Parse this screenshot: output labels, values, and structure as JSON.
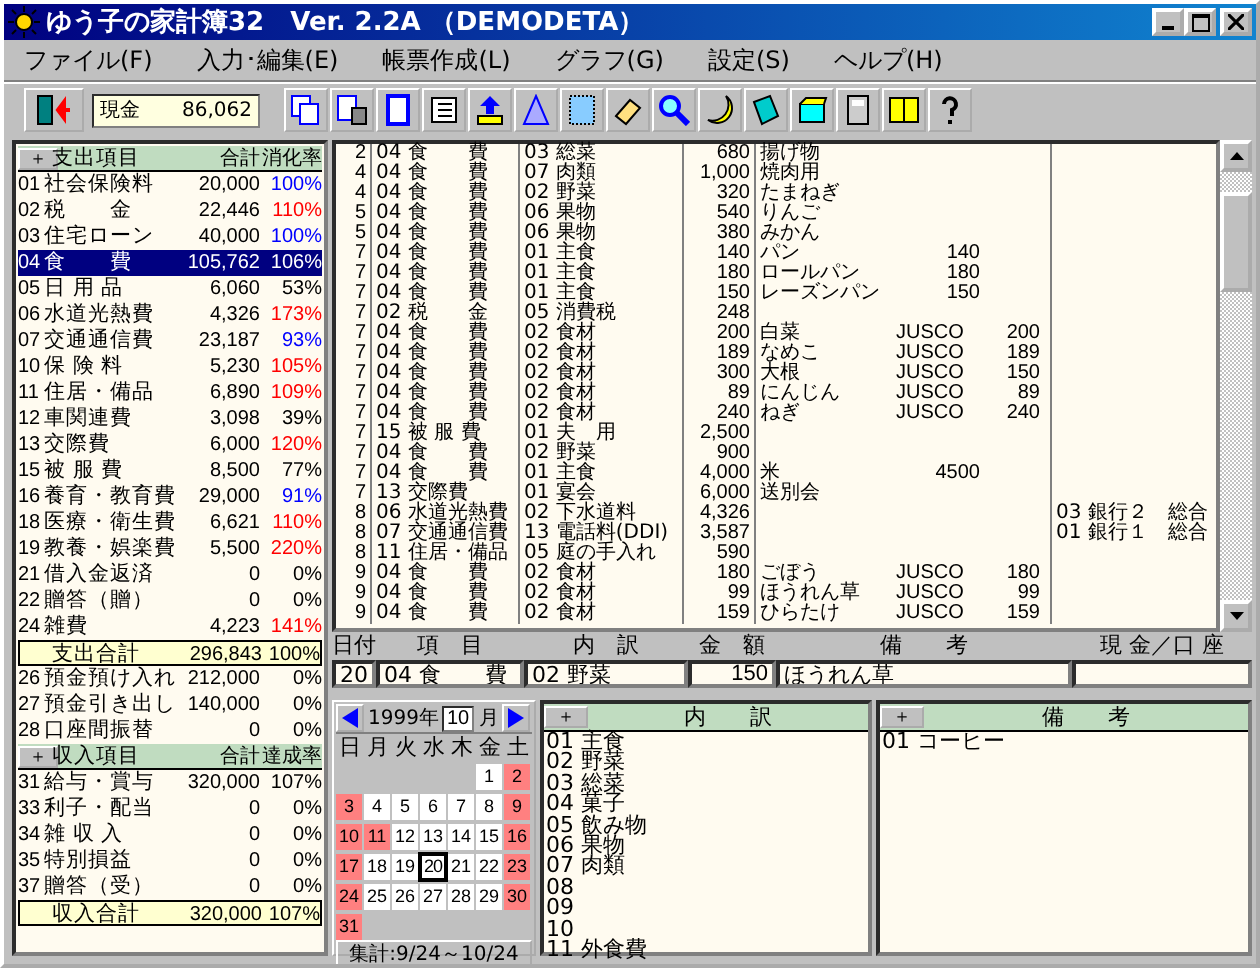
{
  "window": {
    "title": "ゆう子の家計簿32　Ver. 2.2A （DEMODETA）"
  },
  "menu": [
    "ファイル(F)",
    "入力･編集(E)",
    "帳票作成(L)",
    "グラフ(G)",
    "設定(S)",
    "ヘルプ(H)"
  ],
  "toolbar": {
    "cash_label": "現金",
    "cash_value": "86,062"
  },
  "expense": {
    "header": {
      "button": "＋",
      "title": "支出項目",
      "total": "合計",
      "rate": "消化率"
    },
    "items": [
      {
        "code": "01",
        "name": "社会保険料",
        "amount": "20,000",
        "rate": "100%",
        "color": "#0000ff",
        "selected": false
      },
      {
        "code": "02",
        "name": "税　　金",
        "amount": "22,446",
        "rate": "110%",
        "color": "#ff0000",
        "selected": false
      },
      {
        "code": "03",
        "name": "住宅ローン",
        "amount": "40,000",
        "rate": "100%",
        "color": "#0000ff",
        "selected": false
      },
      {
        "code": "04",
        "name": "食　　費",
        "amount": "105,762",
        "rate": "106%",
        "selected": true
      },
      {
        "code": "05",
        "name": "日 用 品",
        "amount": "6,060",
        "rate": "53%",
        "color": "#000000",
        "selected": false
      },
      {
        "code": "06",
        "name": "水道光熱費",
        "amount": "4,326",
        "rate": "173%",
        "color": "#ff0000",
        "selected": false
      },
      {
        "code": "07",
        "name": "交通通信費",
        "amount": "23,187",
        "rate": "93%",
        "color": "#0000ff",
        "selected": false
      },
      {
        "code": "10",
        "name": "保 険 料",
        "amount": "5,230",
        "rate": "105%",
        "color": "#ff0000",
        "selected": false
      },
      {
        "code": "11",
        "name": "住居・備品",
        "amount": "6,890",
        "rate": "109%",
        "color": "#ff0000",
        "selected": false
      },
      {
        "code": "12",
        "name": "車関連費",
        "amount": "3,098",
        "rate": "39%",
        "color": "#000000",
        "selected": false
      },
      {
        "code": "13",
        "name": "交際費",
        "amount": "6,000",
        "rate": "120%",
        "color": "#ff0000",
        "selected": false
      },
      {
        "code": "15",
        "name": "被 服 費",
        "amount": "8,500",
        "rate": "77%",
        "color": "#000000",
        "selected": false
      },
      {
        "code": "16",
        "name": "養育・教育費",
        "amount": "29,000",
        "rate": "91%",
        "color": "#0000ff",
        "selected": false
      },
      {
        "code": "18",
        "name": "医療・衛生費",
        "amount": "6,621",
        "rate": "110%",
        "color": "#ff0000",
        "selected": false
      },
      {
        "code": "19",
        "name": "教養・娯楽費",
        "amount": "5,500",
        "rate": "220%",
        "color": "#ff0000",
        "selected": false
      },
      {
        "code": "21",
        "name": "借入金返済",
        "amount": "0",
        "rate": "0%",
        "color": "#000000",
        "selected": false
      },
      {
        "code": "22",
        "name": "贈答（贈）",
        "amount": "0",
        "rate": "0%",
        "color": "#000000",
        "selected": false
      },
      {
        "code": "24",
        "name": "雑費",
        "amount": "4,223",
        "rate": "141%",
        "color": "#ff0000",
        "selected": false
      }
    ],
    "total": {
      "label": "支出合計",
      "amount": "296,843",
      "rate": "100%"
    }
  },
  "transfers": [
    {
      "code": "26",
      "name": "預金預け入れ",
      "amount": "212,000",
      "rate": "0%"
    },
    {
      "code": "27",
      "name": "預金引き出し",
      "amount": "140,000",
      "rate": "0%"
    },
    {
      "code": "28",
      "name": "口座間振替",
      "amount": "0",
      "rate": "0%"
    }
  ],
  "income": {
    "header": {
      "button": "＋",
      "title": "収入項目",
      "total": "合計",
      "rate": "達成率"
    },
    "items": [
      {
        "code": "31",
        "name": "給与・賞与",
        "amount": "320,000",
        "rate": "107%"
      },
      {
        "code": "33",
        "name": "利子・配当",
        "amount": "0",
        "rate": "0%"
      },
      {
        "code": "34",
        "name": "雑 収 入",
        "amount": "0",
        "rate": "0%"
      },
      {
        "code": "35",
        "name": "特別損益",
        "amount": "0",
        "rate": "0%"
      },
      {
        "code": "37",
        "name": "贈答（受）",
        "amount": "0",
        "rate": "0%"
      }
    ],
    "total": {
      "label": "収入合計",
      "amount": "320,000",
      "rate": "107%"
    }
  },
  "ledger": {
    "rows": [
      {
        "day": "2",
        "category": "04 食　　費",
        "sub": "03 総菜",
        "amount": "680",
        "memo": "揚げ物"
      },
      {
        "day": "4",
        "category": "04 食　　費",
        "sub": "07 肉類",
        "amount": "1,000",
        "memo": "焼肉用"
      },
      {
        "day": "4",
        "category": "04 食　　費",
        "sub": "02 野菜",
        "amount": "320",
        "memo": "たまねぎ"
      },
      {
        "day": "5",
        "category": "04 食　　費",
        "sub": "06 果物",
        "amount": "540",
        "memo": "りんご"
      },
      {
        "day": "5",
        "category": "04 食　　費",
        "sub": "06 果物",
        "amount": "380",
        "memo": "みかん"
      },
      {
        "day": "7",
        "category": "04 食　　費",
        "sub": "01 主食",
        "amount": "140",
        "memo": "パン",
        "memo_amount": "140"
      },
      {
        "day": "7",
        "category": "04 食　　費",
        "sub": "01 主食",
        "amount": "180",
        "memo": "ロールパン",
        "memo_amount": "180"
      },
      {
        "day": "7",
        "category": "04 食　　費",
        "sub": "01 主食",
        "amount": "150",
        "memo": "レーズンパン",
        "memo_amount": "150"
      },
      {
        "day": "7",
        "category": "02 税　　金",
        "sub": "05 消費税",
        "amount": "248"
      },
      {
        "day": "7",
        "category": "04 食　　費",
        "sub": "02 食材",
        "amount": "200",
        "memo": "白菜",
        "store": "JUSCO",
        "memo_amount": "200"
      },
      {
        "day": "7",
        "category": "04 食　　費",
        "sub": "02 食材",
        "amount": "189",
        "memo": "なめこ",
        "store": "JUSCO",
        "memo_amount": "189"
      },
      {
        "day": "7",
        "category": "04 食　　費",
        "sub": "02 食材",
        "amount": "300",
        "memo": "大根",
        "store": "JUSCO",
        "memo_amount": "150"
      },
      {
        "day": "7",
        "category": "04 食　　費",
        "sub": "02 食材",
        "amount": "89",
        "memo": "にんじん",
        "store": "JUSCO",
        "memo_amount": "89"
      },
      {
        "day": "7",
        "category": "04 食　　費",
        "sub": "02 食材",
        "amount": "240",
        "memo": "ねぎ",
        "store": "JUSCO",
        "memo_amount": "240"
      },
      {
        "day": "7",
        "category": "15 被 服 費",
        "sub": "01 夫　用",
        "amount": "2,500"
      },
      {
        "day": "7",
        "category": "04 食　　費",
        "sub": "02 野菜",
        "amount": "900"
      },
      {
        "day": "7",
        "category": "04 食　　費",
        "sub": "01 主食",
        "amount": "4,000",
        "memo": "米",
        "memo_amount": "4500"
      },
      {
        "day": "7",
        "category": "13 交際費",
        "sub": "01 宴会",
        "amount": "6,000",
        "memo": "送別会"
      },
      {
        "day": "8",
        "category": "06 水道光熱費",
        "sub": "02 下水道料",
        "amount": "4,326",
        "account": "03 銀行２　総合"
      },
      {
        "day": "8",
        "category": "07 交通通信費",
        "sub": "13 電話料(DDI)",
        "amount": "3,587",
        "account": "01 銀行１　総合"
      },
      {
        "day": "8",
        "category": "11 住居・備品",
        "sub": "05 庭の手入れ",
        "amount": "590"
      },
      {
        "day": "9",
        "category": "04 食　　費",
        "sub": "02 食材",
        "amount": "180",
        "memo": "ごぼう",
        "store": "JUSCO",
        "memo_amount": "180"
      },
      {
        "day": "9",
        "category": "04 食　　費",
        "sub": "02 食材",
        "amount": "99",
        "memo": "ほうれん草",
        "store": "JUSCO",
        "memo_amount": "99"
      },
      {
        "day": "9",
        "category": "04 食　　費",
        "sub": "02 食材",
        "amount": "159",
        "memo": "ひらたけ",
        "store": "JUSCO",
        "memo_amount": "159"
      }
    ]
  },
  "entry": {
    "labels": [
      "日付",
      "項　目",
      "内　訳",
      "金　額",
      "備　　考",
      "現 金／口 座"
    ],
    "day": "20",
    "category": "04 食　　費",
    "sub": "02 野菜",
    "amount": "150",
    "memo": "ほうれん草"
  },
  "calendar": {
    "year": "1999年",
    "month": "10",
    "month_unit": "月",
    "weekdays": [
      "日",
      "月",
      "火",
      "水",
      "木",
      "金",
      "土"
    ],
    "weeks": [
      {
        "days": [
          {
            "day": "1",
            "holiday": false,
            "selected": false
          },
          {
            "day": "2",
            "holiday": true,
            "selected": false
          }
        ]
      },
      {
        "days": [
          {
            "day": "3",
            "holiday": true,
            "selected": false
          },
          {
            "day": "4",
            "holiday": false,
            "selected": false
          },
          {
            "day": "5",
            "holiday": false,
            "selected": false
          },
          {
            "day": "6",
            "holiday": false,
            "selected": false
          },
          {
            "day": "7",
            "holiday": false,
            "selected": false
          },
          {
            "day": "8",
            "holiday": false,
            "selected": false
          },
          {
            "day": "9",
            "holiday": true,
            "selected": false
          }
        ]
      },
      {
        "days": [
          {
            "day": "10",
            "holiday": true,
            "selected": false
          },
          {
            "day": "11",
            "holiday": true,
            "selected": false
          },
          {
            "day": "12",
            "holiday": false,
            "selected": false
          },
          {
            "day": "13",
            "holiday": false,
            "selected": false
          },
          {
            "day": "14",
            "holiday": false,
            "selected": false
          },
          {
            "day": "15",
            "holiday": false,
            "selected": false
          },
          {
            "day": "16",
            "holiday": true,
            "selected": false
          }
        ]
      },
      {
        "days": [
          {
            "day": "17",
            "holiday": true,
            "selected": false
          },
          {
            "day": "18",
            "holiday": false,
            "selected": false
          },
          {
            "day": "19",
            "holiday": false,
            "selected": false
          },
          {
            "day": "20",
            "holiday": false,
            "selected": true
          },
          {
            "day": "21",
            "holiday": false,
            "selected": false
          },
          {
            "day": "22",
            "holiday": false,
            "selected": false
          },
          {
            "day": "23",
            "holiday": true,
            "selected": false
          }
        ]
      },
      {
        "days": [
          {
            "day": "24",
            "holiday": true,
            "selected": false
          },
          {
            "day": "25",
            "holiday": false,
            "selected": false
          },
          {
            "day": "26",
            "holiday": false,
            "selected": false
          },
          {
            "day": "27",
            "holiday": false,
            "selected": false
          },
          {
            "day": "28",
            "holiday": false,
            "selected": false
          },
          {
            "day": "29",
            "holiday": false,
            "selected": false
          },
          {
            "day": "30",
            "holiday": true,
            "selected": false
          }
        ]
      },
      {
        "days": [
          {
            "day": "31",
            "holiday": true,
            "selected": false
          }
        ]
      }
    ],
    "summary": "集計:9/24～10/24"
  },
  "breakdown": {
    "button": "＋",
    "title": "内　　訳",
    "items": [
      "01 主食",
      "02 野菜",
      "03 総菜",
      "04 菓子",
      "05 飲み物",
      "06 果物",
      "07 肉類",
      "08",
      "09",
      "10",
      "11 外食費"
    ]
  },
  "notes": {
    "button": "＋",
    "title": "備　　考",
    "items": [
      "01 コーヒー"
    ]
  }
}
